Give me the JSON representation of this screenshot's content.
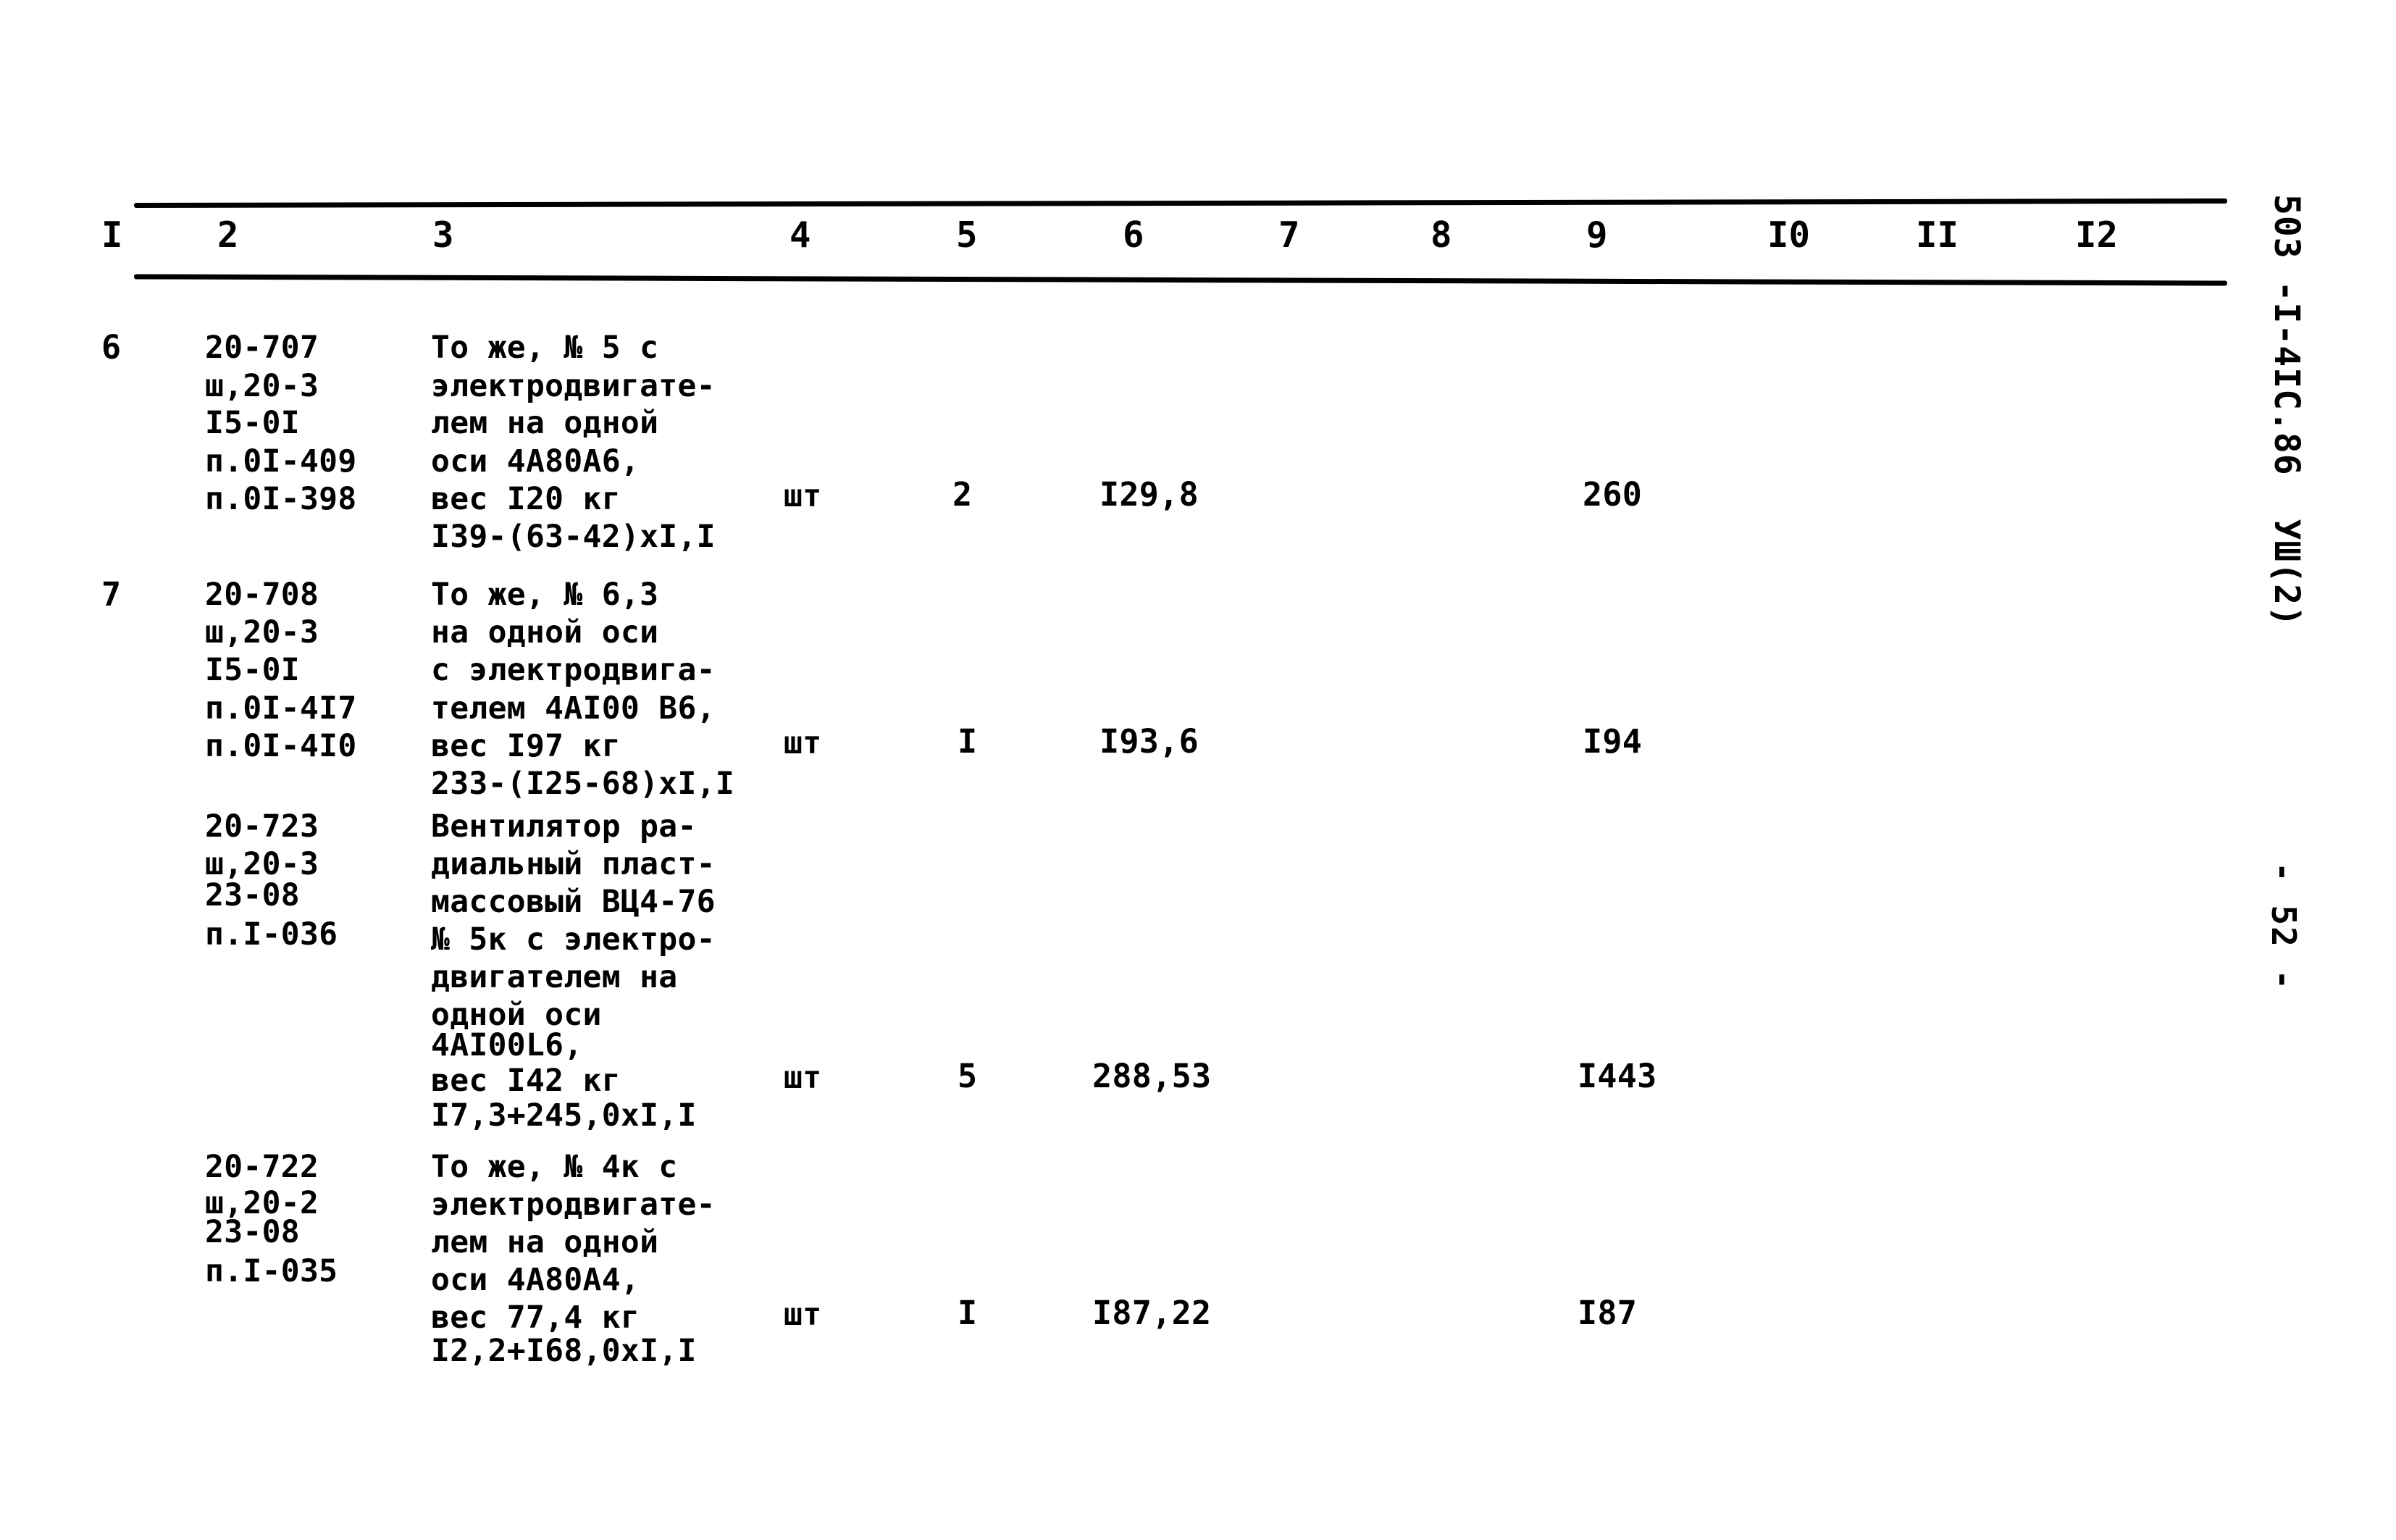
{
  "document": {
    "doc_id_margin": "503 -I-4IC.86  УШ(2)",
    "page_number_margin": "- 52 -"
  },
  "table": {
    "column_headers": [
      "I",
      "2",
      "3",
      "4",
      "5",
      "6",
      "7",
      "8",
      "9",
      "I0",
      "II",
      "I2"
    ],
    "rows": [
      {
        "row_number": "6",
        "codes": [
          "20-707",
          "ш,20-3",
          "I5-0I",
          "п.0I-409",
          "п.0I-398"
        ],
        "description": [
          "То же, № 5 с",
          "электродвигате-",
          "лем на одной",
          "оси 4А80А6,",
          "вес I20 кг",
          "I39-(63-42)хI,I"
        ],
        "unit": "шт",
        "quantity": "2",
        "unit_price": "I29,8",
        "total": "260"
      },
      {
        "row_number": "7",
        "codes": [
          "20-708",
          "ш,20-3",
          "I5-0I",
          "п.0I-4I7",
          "п.0I-4I0"
        ],
        "description": [
          "То же, № 6,3",
          "на одной оси",
          "с электродвига-",
          "телем 4АI00 В6,",
          "вес I97 кг",
          "233-(I25-68)хI,I"
        ],
        "unit": "шт",
        "quantity": "I",
        "unit_price": "I93,6",
        "total": "I94"
      },
      {
        "row_number": "",
        "codes": [
          "20-723",
          "ш,20-3",
          "23-08",
          "п.I-036"
        ],
        "description": [
          "Вентилятор ра-",
          "диальный пласт-",
          "массовый ВЦ4-76",
          "№ 5к с электро-",
          "двигателем на",
          "одной оси",
          "4АI00L6,",
          "вес I42 кг",
          "I7,3+245,0хI,I"
        ],
        "unit": "шт",
        "quantity": "5",
        "unit_price": "288,53",
        "total": "I443"
      },
      {
        "row_number": "",
        "codes": [
          "20-722",
          "ш,20-2",
          "23-08",
          "п.I-035"
        ],
        "description": [
          "То же, № 4к с",
          "электродвигате-",
          "лем на одной",
          "оси 4А80А4,",
          "вес 77,4 кг",
          "I2,2+I68,0хI,I"
        ],
        "unit": "шт",
        "quantity": "I",
        "unit_price": "I87,22",
        "total": "I87"
      }
    ]
  }
}
